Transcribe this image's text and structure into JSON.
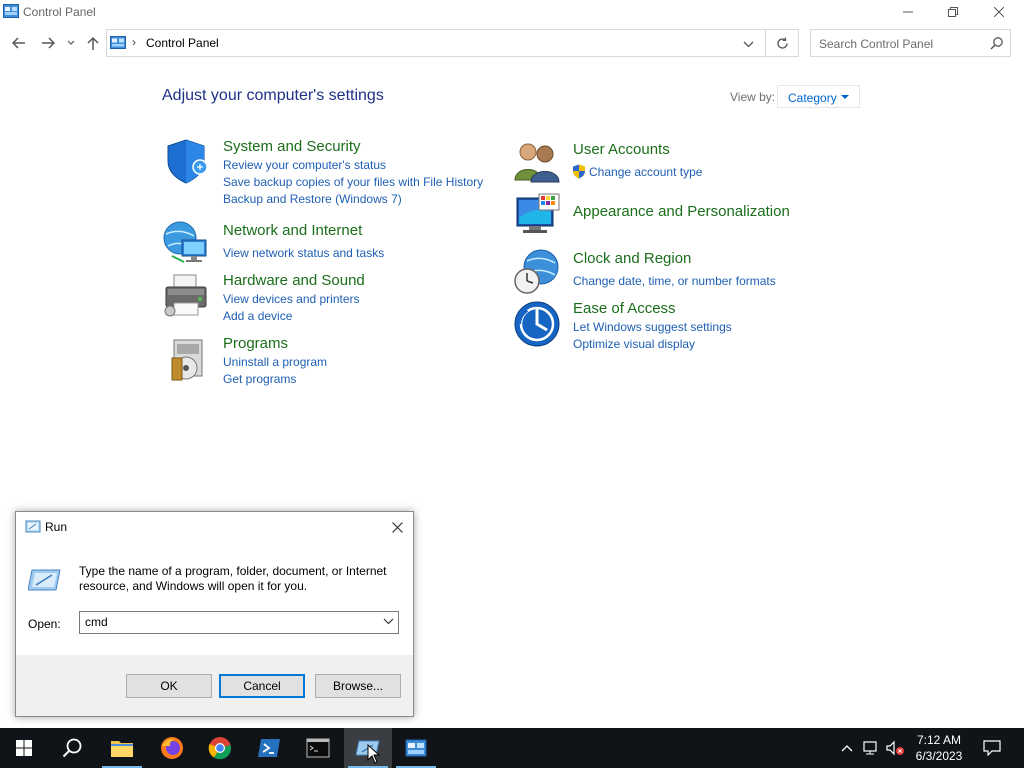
{
  "window": {
    "title": "Control Panel"
  },
  "address": {
    "path": "Control Panel",
    "search_placeholder": "Search Control Panel"
  },
  "content": {
    "heading": "Adjust your computer's settings",
    "view_by_label": "View by:",
    "view_by_value": "Category"
  },
  "categories": {
    "system_security": {
      "title": "System and Security",
      "links": [
        "Review your computer's status",
        "Save backup copies of your files with File History",
        "Backup and Restore (Windows 7)"
      ]
    },
    "network_internet": {
      "title": "Network and Internet",
      "links": [
        "View network status and tasks"
      ]
    },
    "hardware_sound": {
      "title": "Hardware and Sound",
      "links": [
        "View devices and printers",
        "Add a device"
      ]
    },
    "programs": {
      "title": "Programs",
      "links": [
        "Uninstall a program",
        "Get programs"
      ]
    },
    "user_accounts": {
      "title": "User Accounts",
      "links": [
        "Change account type"
      ]
    },
    "appearance": {
      "title": "Appearance and Personalization",
      "links": []
    },
    "clock_region": {
      "title": "Clock and Region",
      "links": [
        "Change date, time, or number formats"
      ]
    },
    "ease_access": {
      "title": "Ease of Access",
      "links": [
        "Let Windows suggest settings",
        "Optimize visual display"
      ]
    }
  },
  "run_dialog": {
    "title": "Run",
    "message": "Type the name of a program, folder, document, or Internet resource, and Windows will open it for you.",
    "open_label": "Open:",
    "open_value": "cmd",
    "ok_label": "OK",
    "cancel_label": "Cancel",
    "browse_label": "Browse..."
  },
  "taskbar": {
    "time": "7:12 AM",
    "date": "6/3/2023",
    "accent_color": "#76b9ed"
  }
}
